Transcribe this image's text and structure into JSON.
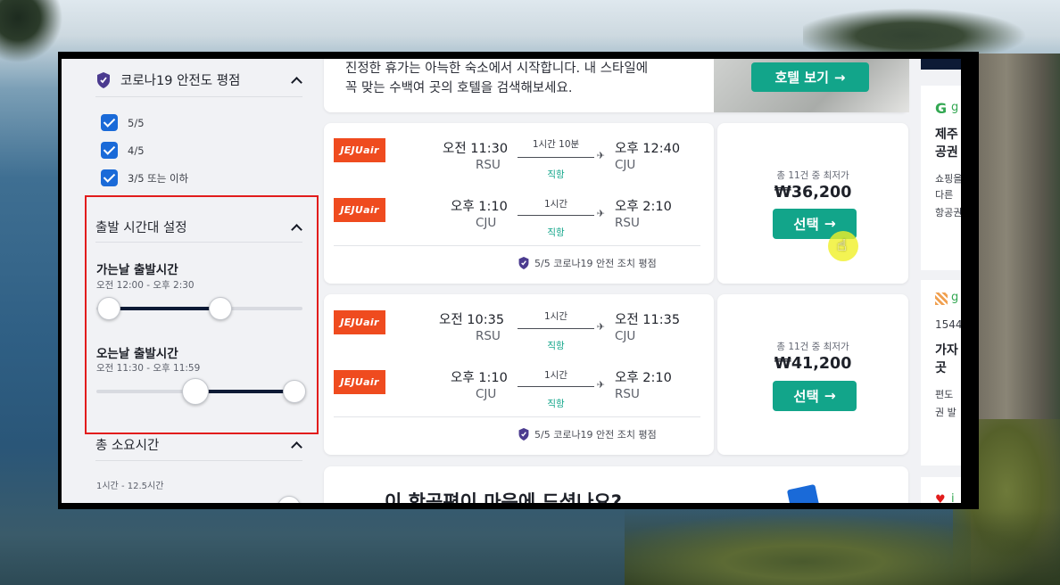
{
  "sidebar": {
    "covid_section": {
      "title": "코로나19 안전도 평점"
    },
    "checkboxes": [
      {
        "label": "5/5",
        "checked": true
      },
      {
        "label": "4/5",
        "checked": true
      },
      {
        "label": "3/5 또는 이하",
        "checked": true
      }
    ],
    "departure_section": {
      "title": "출발 시간대 설정"
    },
    "outbound": {
      "title": "가는날 출발시간",
      "range": "오전 12:00 - 오후 2:30",
      "min_fraction": 0.06,
      "max_fraction": 0.6
    },
    "return": {
      "title": "오는날 출발시간",
      "range": "오전 11:30 - 오후 11:59",
      "min_fraction": 0.48,
      "max_fraction": 1.0
    },
    "duration_section": {
      "title": "총 소요시간",
      "range": "1시간 - 12.5시간"
    }
  },
  "promo": {
    "line1": "진정한 휴가는 아늑한 숙소에서 시작합니다. 내 스타일에",
    "line2": "꼭 맞는 수백여 곳의 호텔을 검색해보세요.",
    "button": "호텔 보기"
  },
  "flights": [
    {
      "legs": [
        {
          "airline": "JEJUair",
          "dep_time": "오전 11:30",
          "dep_code": "RSU",
          "duration": "1시간 10분",
          "stops": "직항",
          "arr_time": "오후 12:40",
          "arr_code": "CJU"
        },
        {
          "airline": "JEJUair",
          "dep_time": "오후 1:10",
          "dep_code": "CJU",
          "duration": "1시간",
          "stops": "직항",
          "arr_time": "오후 2:10",
          "arr_code": "RSU"
        }
      ],
      "safety": "5/5 코로나19 안전 조치 평점",
      "deal_label": "총 11건 중 최저가",
      "price": "₩36,200",
      "select": "선택"
    },
    {
      "legs": [
        {
          "airline": "JEJUair",
          "dep_time": "오전 10:35",
          "dep_code": "RSU",
          "duration": "1시간",
          "stops": "직항",
          "arr_time": "오전 11:35",
          "arr_code": "CJU"
        },
        {
          "airline": "JEJUair",
          "dep_time": "오후 1:10",
          "dep_code": "CJU",
          "duration": "1시간",
          "stops": "직항",
          "arr_time": "오후 2:10",
          "arr_code": "RSU"
        }
      ],
      "safety": "5/5 코로나19 안전 조치 평점",
      "deal_label": "총 11건 중 최저가",
      "price": "₩41,200",
      "select": "선택"
    }
  ],
  "feedback": {
    "title": "이 항공편이 마음에 드셨나요?"
  },
  "ads": [
    {
      "brand": "g",
      "title1": "제주",
      "title2": "공권",
      "lines": [
        "쇼핑을",
        "다른 ",
        "항공권"
      ]
    },
    {
      "brand": "g",
      "phone": "1544",
      "title1": "가자",
      "title2": "곳",
      "lines": [
        "편도 ",
        "권 발"
      ]
    },
    {
      "brand": "i"
    }
  ],
  "colors": {
    "accent": "#12a58a",
    "checkbox": "#1a6ad8",
    "highlight": "#e21c1c",
    "logo": "#ef4b1f"
  }
}
